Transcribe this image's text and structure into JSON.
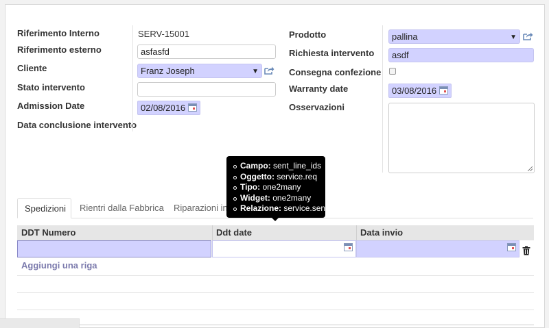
{
  "form": {
    "left": {
      "riferimento_interno": {
        "label": "Riferimento Interno",
        "value": "SERV-15001"
      },
      "riferimento_esterno": {
        "label": "Riferimento esterno",
        "value": "asfasfd"
      },
      "cliente": {
        "label": "Cliente",
        "value": "Franz Joseph"
      },
      "stato_intervento": {
        "label": "Stato intervento",
        "value": ""
      },
      "admission_date": {
        "label": "Admission Date",
        "value": "02/08/2016"
      },
      "data_conclusione": {
        "label": "Data conclusione intervento"
      }
    },
    "right": {
      "prodotto": {
        "label": "Prodotto",
        "value": "pallina"
      },
      "richiesta_intervento": {
        "label": "Richiesta intervento",
        "value": "asdf"
      },
      "consegna_confezione": {
        "label": "Consegna confezione",
        "checked": false
      },
      "warranty_date": {
        "label": "Warranty date",
        "value": "03/08/2016"
      },
      "osservazioni": {
        "label": "Osservazioni",
        "value": ""
      }
    }
  },
  "tabs": [
    {
      "label": "Spedizioni",
      "active": true
    },
    {
      "label": "Rientri dalla Fabbrica",
      "active": false
    },
    {
      "label": "Riparazioni in s",
      "active": false
    }
  ],
  "table": {
    "columns": [
      "DDT Numero",
      "Ddt date",
      "Data invio"
    ],
    "add_row_label": "Aggiungi una riga"
  },
  "tooltip": {
    "items": [
      {
        "key": "Campo:",
        "value": "sent_line_ids"
      },
      {
        "key": "Oggetto:",
        "value": "service.req"
      },
      {
        "key": "Tipo:",
        "value": "one2many"
      },
      {
        "key": "Widget:",
        "value": "one2many"
      },
      {
        "key": "Relazione:",
        "value": "service.sent"
      }
    ]
  },
  "colors": {
    "required_field": "#d2d2ff",
    "link": "#7c7bad"
  },
  "icons": {
    "external_link": "external-link-icon",
    "calendar": "calendar-icon",
    "trash": "trash-icon",
    "dropdown": "chevron-down-icon"
  }
}
